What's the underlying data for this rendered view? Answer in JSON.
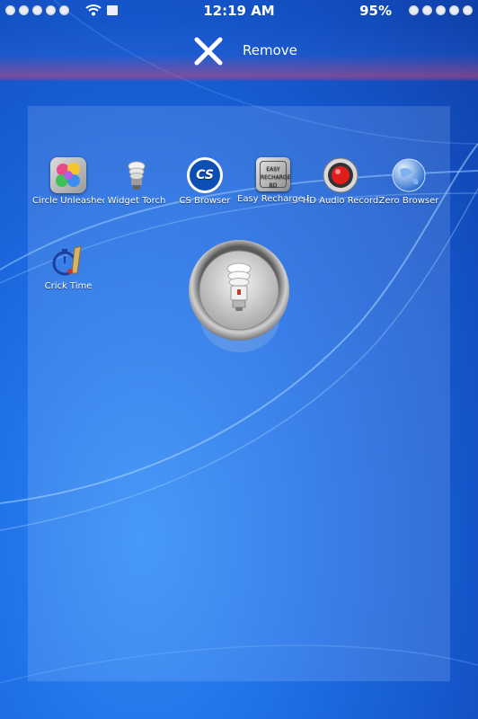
{
  "status_bar": {
    "time": "12:19 AM",
    "battery": "95%"
  },
  "remove_zone": {
    "label": "Remove",
    "icon": "close-icon"
  },
  "apps": [
    {
      "label": "Circle Unleashed",
      "icon": "circle-unleashed-icon"
    },
    {
      "label": "Widget Torch",
      "icon": "torch-icon"
    },
    {
      "label": "CS Browser",
      "icon": "cs-browser-icon",
      "icon_text": "CS"
    },
    {
      "label": "Easy Recharge BD",
      "icon": "easy-recharge-icon",
      "icon_text": "EASY RECHARGE BD"
    },
    {
      "label": "HD Audio Record",
      "icon": "audio-record-icon"
    },
    {
      "label": "Zero Browser",
      "icon": "globe-icon"
    },
    {
      "label": "Crick Time",
      "icon": "stopwatch-icon"
    }
  ],
  "dragged_item": {
    "icon": "torch-widget-icon"
  }
}
